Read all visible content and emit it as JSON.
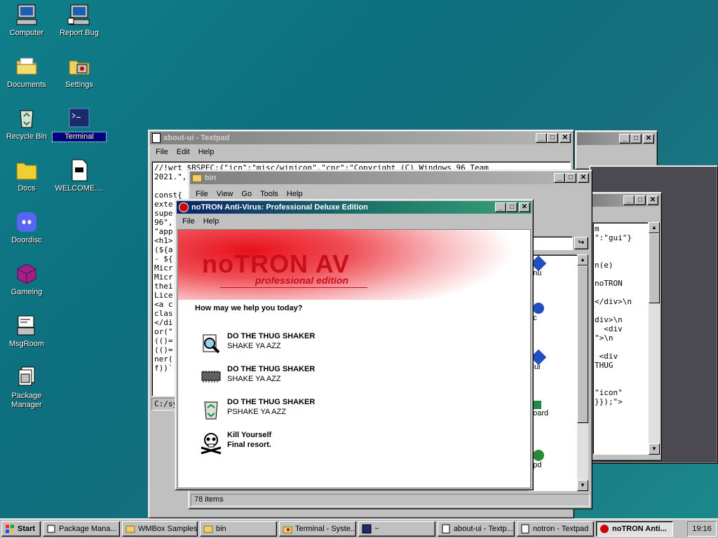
{
  "desktop": {
    "icons": [
      {
        "label": "Computer"
      },
      {
        "label": "Report Bug"
      },
      {
        "label": "Documents"
      },
      {
        "label": "Settings"
      },
      {
        "label": "Recycle Bin"
      },
      {
        "label": "Terminal"
      },
      {
        "label": "Docs"
      },
      {
        "label": "WELCOME...."
      },
      {
        "label": "Doordisc"
      },
      {
        "label": "Gameing"
      },
      {
        "label": "MsgRoom"
      },
      {
        "label": "Package Manager"
      }
    ]
  },
  "textpad": {
    "title": "about-ui - Textpad",
    "menu": [
      "File",
      "Edit",
      "Help"
    ],
    "lines": [
      "//!wrt $BSPEC:{\"icn\":\"misc/winicon\",\"cpr\":\"Copyright (C) Windows 96 Team",
      "2021.\",",
      "",
      "const{",
      "exte",
      "supe",
      "96\",",
      "\"app",
      "<h1>",
      "(${a",
      "- ${",
      "Micr",
      "Micr",
      "thei",
      "Lice",
      "<a c",
      "clas",
      "</di",
      "or(\"",
      "(()=",
      "(()=",
      "ner(",
      "f))`"
    ],
    "status": "C:/sys"
  },
  "back_window": {
    "lines": [
      "m",
      "\":\"gui\"}",
      "",
      "",
      "n(e)",
      "",
      "noTRON",
      "",
      "</div>\\n",
      "",
      "div>\\n",
      "  <div",
      "\">\\n",
      "",
      " <div",
      "THUG",
      "",
      "",
      "\"icon\"",
      "}});\">"
    ]
  },
  "explorer": {
    "title": "bin",
    "menu": [
      "File",
      "View",
      "Go",
      "Tools",
      "Help"
    ],
    "partial_items": [
      "enu",
      "nc",
      "clui",
      "board",
      "upd"
    ],
    "status": "78 items"
  },
  "av": {
    "title": "noTRON Anti-Virus: Professional Deluxe Edition",
    "menu": [
      "File",
      "Help"
    ],
    "brand": "noTRON AV",
    "edition": "professional edition",
    "prompt": "How may we help you today?",
    "options": [
      {
        "icon": "magnifier-icon",
        "title": "DO THE THUG SHAKER",
        "subtitle": "SHAKE YA AZZ"
      },
      {
        "icon": "chip-icon",
        "title": "DO THE THUG SHAKER",
        "subtitle": "SHAKE YA AZZ"
      },
      {
        "icon": "recycle-icon",
        "title": "DO THE THUG SHAKER",
        "subtitle": "PSHAKE YA AZZ"
      },
      {
        "icon": "skull-icon",
        "title": "Kill Yourself",
        "subtitle": "Final resort."
      }
    ]
  },
  "taskbar": {
    "start": "Start",
    "tasks": [
      {
        "label": "Package Mana..."
      },
      {
        "label": "WMBox Samples"
      },
      {
        "label": "bin"
      },
      {
        "label": "Terminal - Syste..."
      },
      {
        "label": "~"
      },
      {
        "label": "about-ui - Textp..."
      },
      {
        "label": "notron - Textpad"
      },
      {
        "label": "noTRON Anti..."
      }
    ],
    "clock": "19:16"
  },
  "colors": {
    "accent": "#000080",
    "brand_red": "#c8102e",
    "desktop": "#0f7f8a"
  }
}
